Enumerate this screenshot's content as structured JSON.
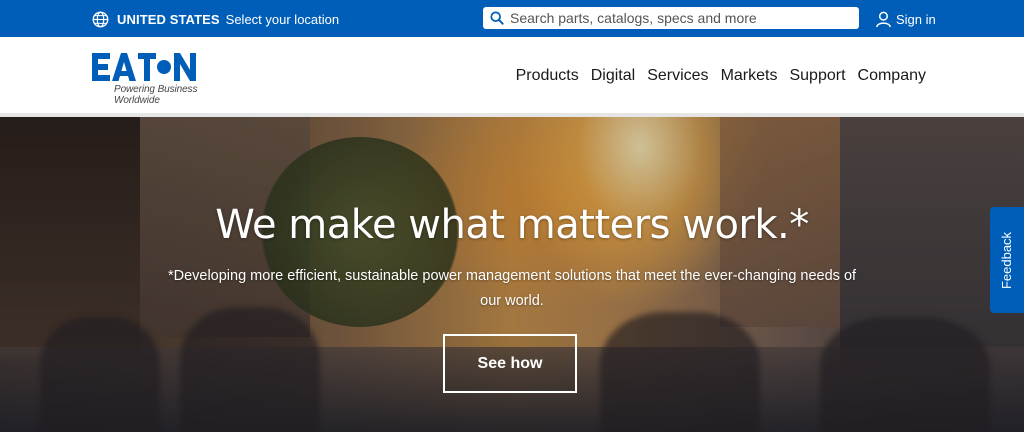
{
  "utility": {
    "country": "UNITED STATES",
    "select_location": "Select your location",
    "search_placeholder": "Search parts, catalogs, specs and more",
    "signin": "Sign in"
  },
  "brand": {
    "logo_text": "EATON",
    "tagline": "Powering Business Worldwide",
    "color": "#005eb8"
  },
  "nav": {
    "items": [
      "Products",
      "Digital",
      "Services",
      "Markets",
      "Support",
      "Company"
    ]
  },
  "hero": {
    "title": "We make what matters work.*",
    "subtitle": "*Developing more efficient, sustainable power management solutions that meet the ever-changing needs of our world.",
    "cta": "See how"
  },
  "feedback": {
    "label": "Feedback"
  },
  "icons": {
    "globe": "globe-icon",
    "search": "search-icon",
    "user": "user-icon"
  }
}
